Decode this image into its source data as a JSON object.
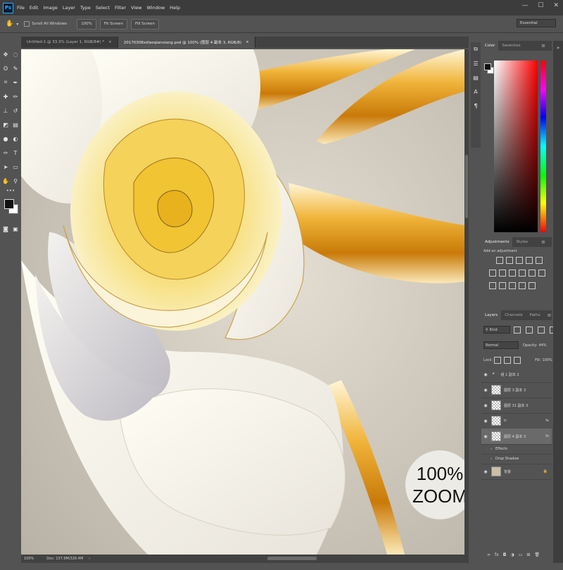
{
  "app": {
    "logo": "Ps"
  },
  "menu": [
    "File",
    "Edit",
    "Image",
    "Layer",
    "Type",
    "Select",
    "Filter",
    "View",
    "Window",
    "Help"
  ],
  "window_controls": {
    "minimize": "—",
    "maximize": "☐",
    "close": "✕"
  },
  "options_bar": {
    "scroll_all_windows": "Scroll All Windows",
    "zoom_100": "100%",
    "fit_screen": "Fit Screen",
    "fill_screen": "Fill Screen",
    "workspace": "Essential"
  },
  "tabs": [
    {
      "label": "Untitled-1 @ 33.3% (Layer 1, RGB/8#) *",
      "active": false
    },
    {
      "label": "20170308xdlaoqianxiang.psd @ 100% (图层 4 副本 3, RGB/8)",
      "active": true
    }
  ],
  "tools": [
    [
      "move-tool",
      "✥",
      "marquee-tool",
      "◌"
    ],
    [
      "lasso-tool",
      "ʘ",
      "quick-select-tool",
      "✎"
    ],
    [
      "crop-tool",
      "⌗",
      "eyedropper-tool",
      "✒"
    ],
    [
      "healing-tool",
      "✚",
      "brush-tool",
      "✏"
    ],
    [
      "stamp-tool",
      "⊥",
      "history-brush-tool",
      "↺"
    ],
    [
      "eraser-tool",
      "◩",
      "gradient-tool",
      "▤"
    ],
    [
      "blur-tool",
      "●",
      "dodge-tool",
      "◐"
    ],
    [
      "pen-tool",
      "✑",
      "type-tool",
      "T"
    ],
    [
      "path-select-tool",
      "➤",
      "shape-tool",
      "▭"
    ],
    [
      "hand-tool",
      "✋",
      "zoom-tool",
      "⚲"
    ]
  ],
  "status": {
    "zoom": "100%",
    "doc": "Doc: 137.9M/326.4M"
  },
  "badge": {
    "line1": "100%",
    "line2": "ZOOM"
  },
  "color_panel": {
    "tabs": [
      "Color",
      "Swatches"
    ]
  },
  "adjustments_panel": {
    "tabs": [
      "Adjustments",
      "Styles"
    ],
    "add_label": "Add an adjustment"
  },
  "layers_panel": {
    "tabs": [
      "Layers",
      "Channels",
      "Paths"
    ],
    "kind": "Kind",
    "blend_mode": "Normal",
    "opacity_label": "Opacity:",
    "opacity_value": "44%",
    "lock_label": "Lock:",
    "fill_label": "Fill:",
    "fill_value": "100%",
    "layers": [
      {
        "name": "组 1 副本 2",
        "kind": "group",
        "fx": false
      },
      {
        "name": "图层 3 副本 3",
        "kind": "layer",
        "fx": false
      },
      {
        "name": "图层 31 副本 3",
        "kind": "layer",
        "fx": false
      },
      {
        "name": "tr",
        "kind": "layer",
        "fx": true
      },
      {
        "name": "图层 4 副本 3",
        "kind": "layer",
        "fx": true,
        "selected": true
      },
      {
        "name": "Effects",
        "kind": "effect",
        "fx": false
      },
      {
        "name": "Drop Shadow",
        "kind": "effect",
        "fx": false
      },
      {
        "name": "背景",
        "kind": "background",
        "fx": false
      }
    ],
    "fx_label": "fx"
  },
  "colors": {
    "foreground": "#111111",
    "background": "#ffffff",
    "accent": "#31a8ff"
  }
}
